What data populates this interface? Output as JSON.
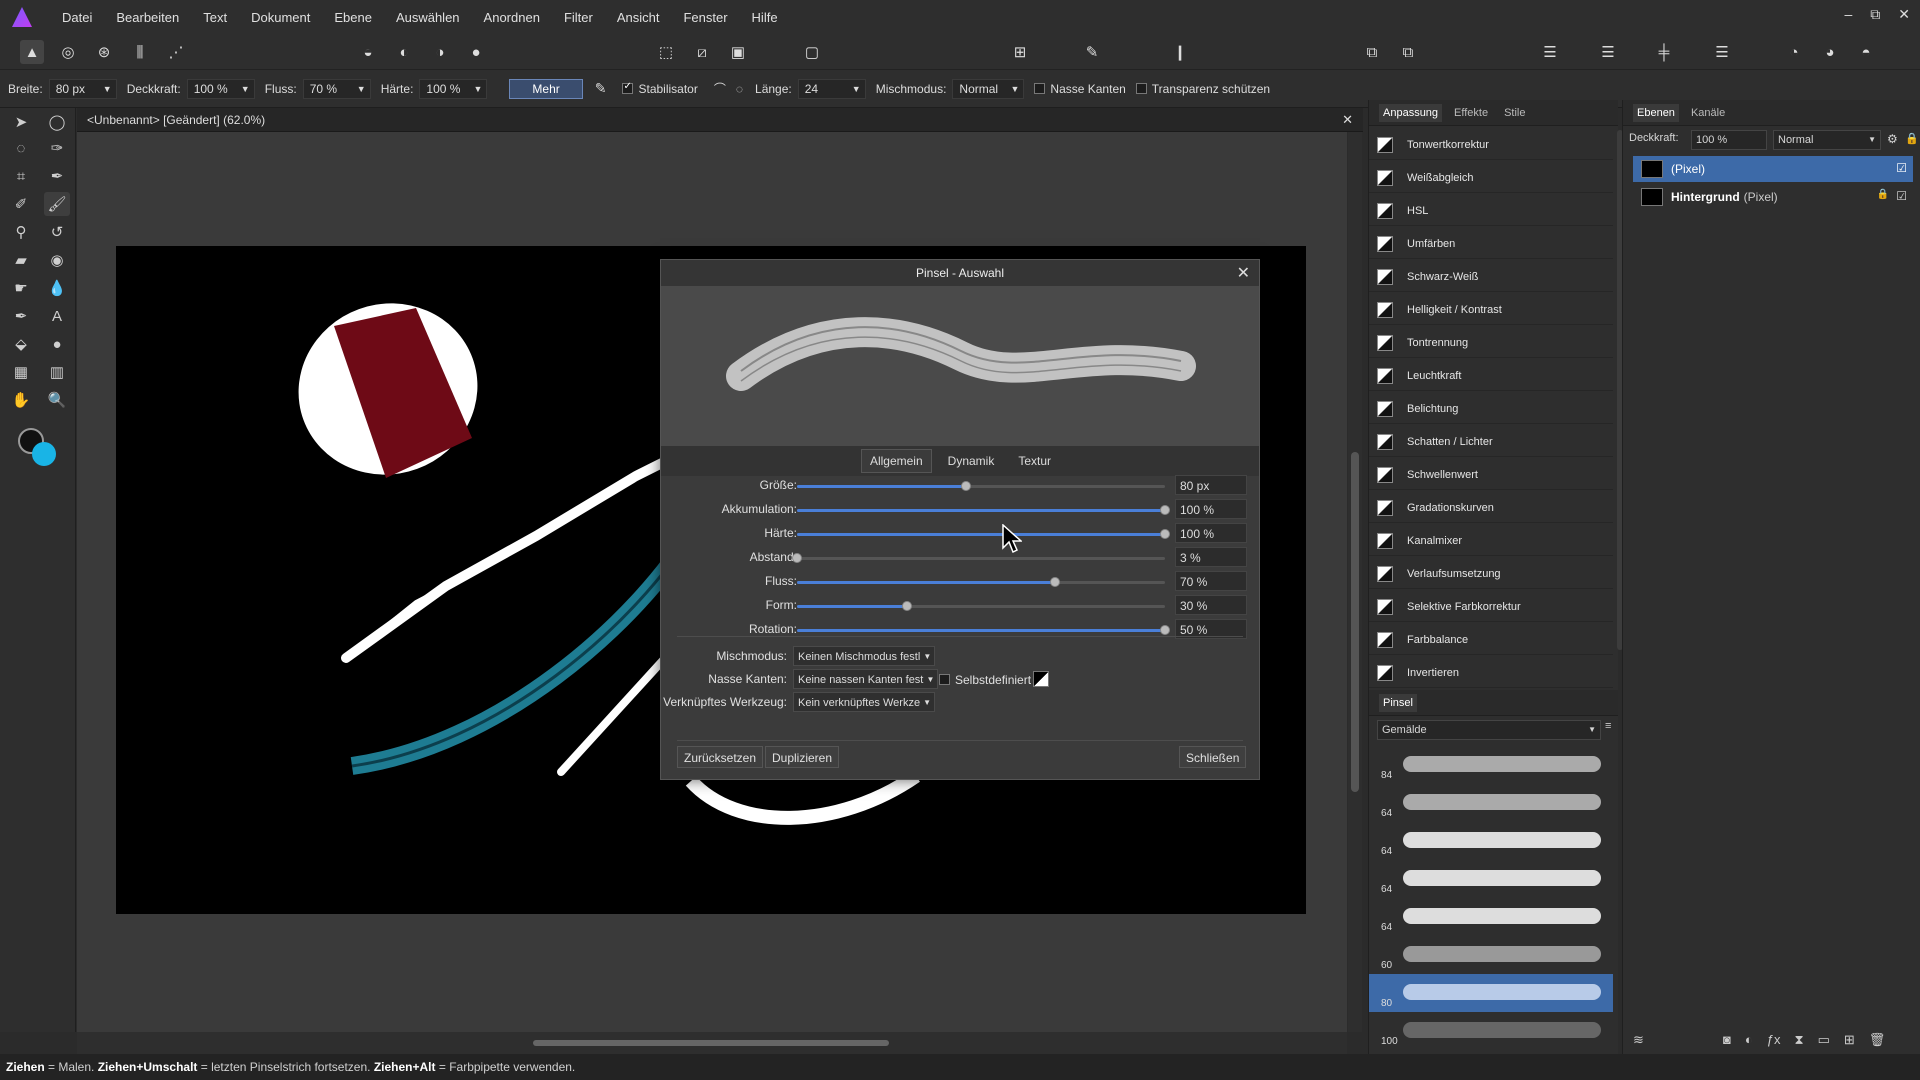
{
  "menubar": {
    "items": [
      "Datei",
      "Bearbeiten",
      "Text",
      "Dokument",
      "Ebene",
      "Auswählen",
      "Anordnen",
      "Filter",
      "Ansicht",
      "Fenster",
      "Hilfe"
    ],
    "window_controls": [
      "–",
      "⧉",
      "✕"
    ]
  },
  "context": {
    "breite_label": "Breite:",
    "breite_value": "80 px",
    "deckkraft_label": "Deckkraft:",
    "deckkraft_value": "100 %",
    "fluss_label": "Fluss:",
    "fluss_value": "70 %",
    "haerte_label": "Härte:",
    "haerte_value": "100 %",
    "mehr_label": "Mehr",
    "stabilisator_label": "Stabilisator",
    "laenge_label": "Länge:",
    "laenge_value": "24",
    "mischmodus_label": "Mischmodus:",
    "mischmodus_value": "Normal",
    "nasse_kanten_label": "Nasse Kanten",
    "transparenz_label": "Transparenz schützen"
  },
  "document": {
    "tab_title": "<Unbenannt> [Geändert] (62.0%)"
  },
  "dialog": {
    "title": "Pinsel - Auswahl",
    "tabs": [
      "Allgemein",
      "Dynamik",
      "Textur"
    ],
    "sliders": [
      {
        "label": "Größe:",
        "value": "80 px",
        "level": 0.46
      },
      {
        "label": "Akkumulation:",
        "value": "100 %",
        "level": 1.0
      },
      {
        "label": "Härte:",
        "value": "100 %",
        "level": 1.0
      },
      {
        "label": "Abstand:",
        "value": "3 %",
        "level": 0.0
      },
      {
        "label": "Fluss:",
        "value": "70 %",
        "level": 0.7
      },
      {
        "label": "Form:",
        "value": "30 %",
        "level": 0.3
      },
      {
        "label": "Rotation:",
        "value": "50 %",
        "level": 1.0
      }
    ],
    "mischmodus_label": "Mischmodus:",
    "mischmodus_value": "Keinen Mischmodus festl",
    "nasse_kanten_label": "Nasse Kanten:",
    "nasse_kanten_value": "Keine nassen Kanten fest",
    "selbstdefiniert_label": "Selbstdefiniert",
    "werkzeug_label": "Verknüpftes Werkzeug:",
    "werkzeug_value": "Kein verknüpftes Werkze",
    "reset_label": "Zurücksetzen",
    "duplicate_label": "Duplizieren",
    "close_label": "Schließen"
  },
  "adjust_panel": {
    "tabs": [
      "Anpassung",
      "Effekte",
      "Stile"
    ],
    "items": [
      "Tonwertkorrektur",
      "Weißabgleich",
      "HSL",
      "Umfärben",
      "Schwarz-Weiß",
      "Helligkeit / Kontrast",
      "Tontrennung",
      "Leuchtkraft",
      "Belichtung",
      "Schatten / Lichter",
      "Schwellenwert",
      "Gradationskurven",
      "Kanalmixer",
      "Verlaufsumsetzung",
      "Selektive Farbkorrektur",
      "Farbbalance",
      "Invertieren"
    ]
  },
  "brush_panel": {
    "title": "Pinsel",
    "category": "Gemälde",
    "sizes": [
      "84",
      "64",
      "64",
      "64",
      "64",
      "60",
      "80",
      "100"
    ]
  },
  "layers_panel": {
    "tabs": [
      "Ebenen",
      "Kanäle"
    ],
    "deckkraft_label": "Deckkraft:",
    "deckkraft_value": "100 %",
    "blend_value": "Normal",
    "layers": [
      {
        "name": "(Pixel)",
        "selected": true
      },
      {
        "name": "Hintergrund",
        "suffix": "(Pixel)",
        "selected": false
      }
    ]
  },
  "status": {
    "a": "Ziehen",
    "b": " = Malen. ",
    "c": "Ziehen+Umschalt",
    "d": " = letzten Pinselstrich fortsetzen. ",
    "e": "Ziehen+Alt",
    "f": " = Farbpipette verwenden."
  },
  "colors": {
    "accent": "#4a7fd8",
    "primary_color": "#111111",
    "secondary_color": "#19b4e6"
  }
}
